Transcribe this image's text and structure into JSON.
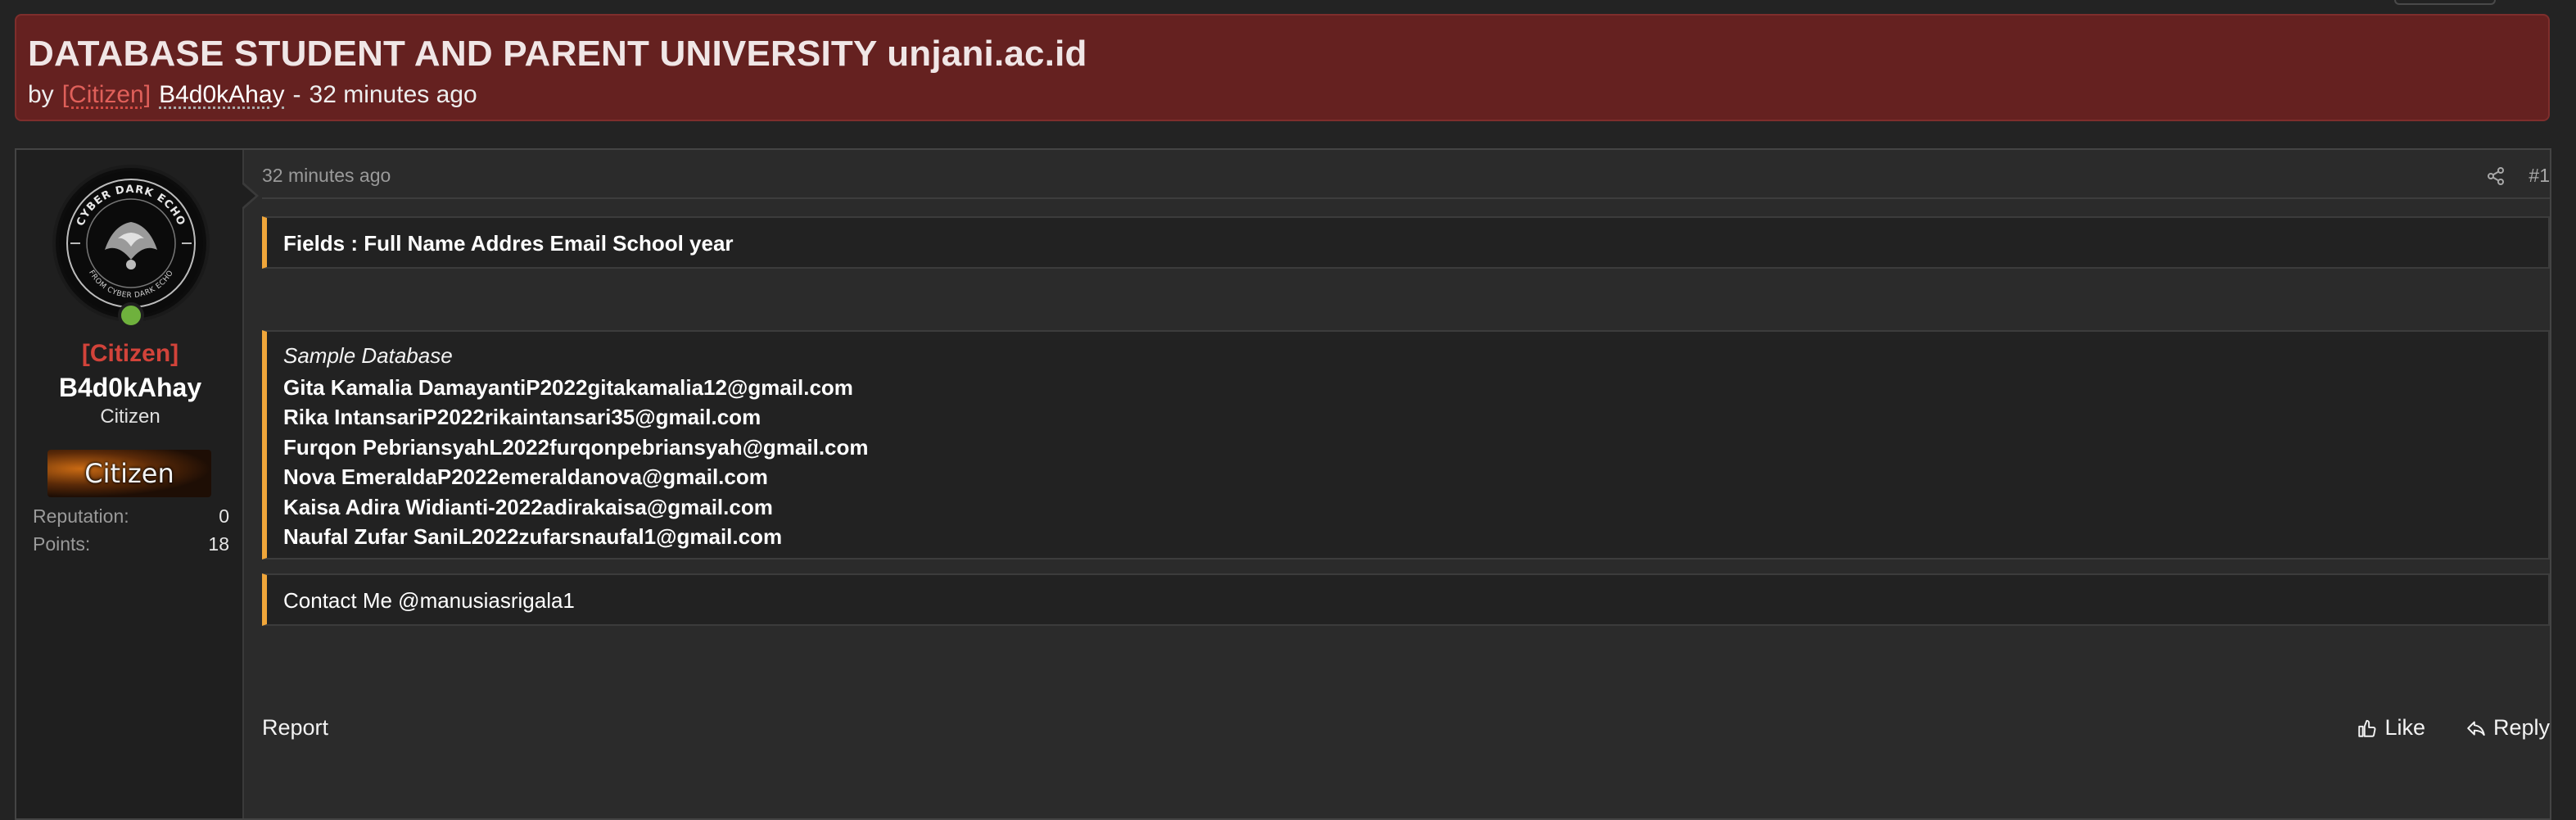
{
  "thread": {
    "title": "DATABASE STUDENT AND PARENT UNIVERSITY unjani.ac.id",
    "meta_by": "by",
    "author_tag": "[Citizen]",
    "author_name": "B4d0kAhay",
    "meta_separator": "-",
    "posted": "32 minutes ago"
  },
  "sidebar": {
    "avatar_text": [
      "CYBER DARK ECHO",
      "FROM CYBER DARK ECHO"
    ],
    "user_tag": "[Citizen]",
    "username": "B4d0kAhay",
    "user_title": "Citizen",
    "rank_banner": "Citizen",
    "stats": [
      {
        "label": "Reputation:",
        "value": "0"
      },
      {
        "label": "Points:",
        "value": "18"
      }
    ]
  },
  "post": {
    "time": "32 minutes ago",
    "number": "#1",
    "share_icon": "share-icon",
    "fields_line": "Fields : Full Name Addres Email School year",
    "sample_intro": "Sample Database",
    "sample_rows": [
      "Gita Kamalia DamayantiP2022gitakamalia12@gmail.com",
      "Rika IntansariP2022rikaintansari35@gmail.com",
      "Furqon PebriansyahL2022furqonpebriansyah@gmail.com",
      "Nova EmeraldaP2022emeraldanova@gmail.com",
      "Kaisa Adira Widianti-2022adirakaisa@gmail.com",
      "Naufal Zufar SaniL2022zufarsnaufal1@gmail.com"
    ],
    "contact_line": "Contact Me @manusiasrigala1"
  },
  "actions": {
    "report": "Report",
    "like": "Like",
    "reply": "Reply",
    "like_icon": "thumbs-up-icon",
    "reply_icon": "reply-icon"
  },
  "colors": {
    "header_bg": "#652120",
    "quote_accent": "#f0a63a",
    "citizen_tag": "#d2433a",
    "online": "#6fb13d"
  }
}
